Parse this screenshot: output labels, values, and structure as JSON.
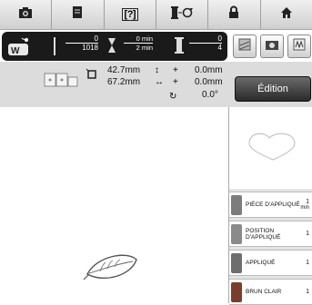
{
  "toolbar": {
    "buttons": [
      {
        "name": "camera-button",
        "icon": "camera-icon"
      },
      {
        "name": "memory-button",
        "icon": "document-icon"
      },
      {
        "name": "help-button",
        "icon": "help-icon",
        "label": "[?]"
      },
      {
        "name": "thread-cut-button",
        "icon": "thread-icon"
      },
      {
        "name": "lock-button",
        "icon": "lock-icon"
      },
      {
        "name": "home-button",
        "icon": "home-icon"
      }
    ]
  },
  "status": {
    "stitch_current": "0",
    "stitch_total": "1018",
    "time_current": "0 min",
    "time_total": "2 min",
    "color_current": "0",
    "color_total": "4"
  },
  "info": {
    "size_width": "42.7mm",
    "size_height": "67.2mm",
    "offset_v": "0.0mm",
    "offset_h": "0.0mm",
    "rotation": "0.0°",
    "edit_label": "Édition"
  },
  "threads": [
    {
      "name": "PIÈCE D'APPLIQUÉ",
      "count": "1",
      "unit": "min",
      "color": "#7c7c7c"
    },
    {
      "name": "POSITION D'APPLIQUÉ",
      "count": "1",
      "unit": "",
      "color": "#8a8a8a"
    },
    {
      "name": "APPLIQUÉ",
      "count": "1",
      "unit": "",
      "color": "#6e6e6e"
    },
    {
      "name": "BRUN CLAIR",
      "count": "1",
      "unit": "",
      "color": "#7a3d2c"
    }
  ],
  "colors": {
    "bar": "#1a1a1a",
    "accent": "#7a3d2c"
  }
}
